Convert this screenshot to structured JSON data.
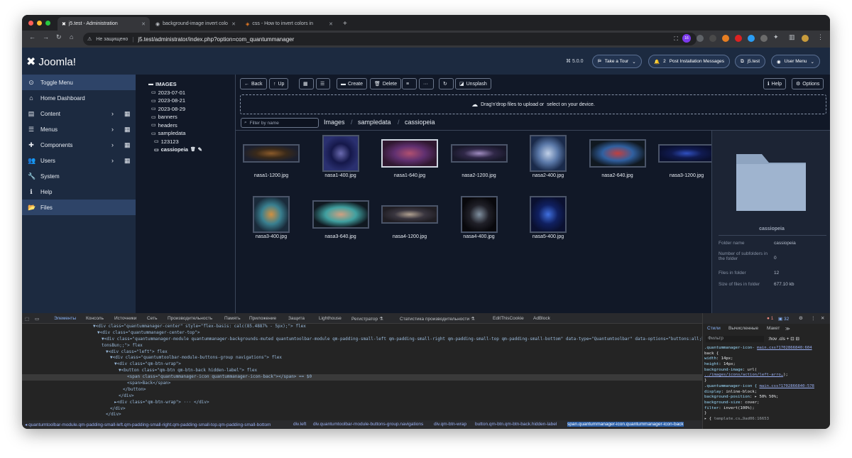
{
  "browser": {
    "tabs": [
      {
        "title": "j5.test - Administration"
      },
      {
        "title": "background-image invert colo"
      },
      {
        "title": "css - How to invert colors in"
      }
    ],
    "new_tab": "+",
    "security": "Не защищено",
    "url": "j5.test/administrator/index.php?option=com_quantummanager",
    "ext_badge": "16"
  },
  "header": {
    "brand": "Joomla!",
    "version": "⌘ 5.0.0",
    "tour": "Take a Tour",
    "notif_count": "2",
    "post_install": "Post Installation Messages",
    "site": "j5.test",
    "user_menu": "User Menu"
  },
  "sidebar": {
    "items": [
      {
        "label": "Toggle Menu",
        "icon": "⊙"
      },
      {
        "label": "Home Dashboard",
        "icon": "⌂"
      },
      {
        "label": "Content",
        "icon": "▤",
        "chev": "›",
        "grid": "▦"
      },
      {
        "label": "Menus",
        "icon": "☰",
        "chev": "›",
        "grid": "▦"
      },
      {
        "label": "Components",
        "icon": "✚",
        "chev": "›",
        "grid": "▦"
      },
      {
        "label": "Users",
        "icon": "👥",
        "chev": "›",
        "grid": "▦"
      },
      {
        "label": "System",
        "icon": "🔧"
      },
      {
        "label": "Help",
        "icon": "ℹ"
      },
      {
        "label": "Files",
        "icon": "📂"
      }
    ]
  },
  "tree": {
    "items": [
      {
        "label": "IMAGES",
        "level": 0,
        "bold": true
      },
      {
        "label": "2023-07-01",
        "level": 1
      },
      {
        "label": "2023-08-21",
        "level": 1
      },
      {
        "label": "2023-08-29",
        "level": 1
      },
      {
        "label": "banners",
        "level": 1
      },
      {
        "label": "headers",
        "level": 1
      },
      {
        "label": "sampledata",
        "level": 1
      },
      {
        "label": "123123",
        "level": 2
      },
      {
        "label": "cassiopeia",
        "level": 2,
        "bold": true
      }
    ]
  },
  "toolbar": {
    "back": "Back",
    "up": "Up",
    "create": "Create",
    "delete": "Delete",
    "more": "···",
    "unsplash": "Unsplash",
    "help": "Help",
    "options": "Options"
  },
  "dropzone": {
    "text1": "Drag'n'drop files to upload or",
    "text2": "select on your device."
  },
  "filter_placeholder": "Filter by name",
  "breadcrumbs": [
    "Images",
    "sampledata",
    "cassiopeia"
  ],
  "files": [
    {
      "name": "nasa1-1200.jpg",
      "colors": [
        "#1b1f2e",
        "#8a5a2a",
        "#3a2a1a"
      ]
    },
    {
      "name": "nasa1-400.jpg",
      "colors": [
        "#2a3070",
        "#6a6ab0",
        "#15184a"
      ]
    },
    {
      "name": "nasa1-640.jpg",
      "colors": [
        "#301830",
        "#b05070",
        "#603070"
      ]
    },
    {
      "name": "nasa2-1200.jpg",
      "colors": [
        "#18182a",
        "#a08cc0",
        "#302848"
      ]
    },
    {
      "name": "nasa2-400.jpg",
      "colors": [
        "#1a2a4a",
        "#c0d0e8",
        "#5a78a8"
      ]
    },
    {
      "name": "nasa2-640.jpg",
      "colors": [
        "#101820",
        "#c04040",
        "#3060a0"
      ]
    },
    {
      "name": "nasa3-1200.jpg",
      "colors": [
        "#0a1030",
        "#3050c0",
        "#101a50"
      ]
    },
    {
      "name": "nasa3-400.jpg",
      "colors": [
        "#1a2a3a",
        "#d09040",
        "#3a8090"
      ]
    },
    {
      "name": "nasa3-640.jpg",
      "colors": [
        "#101820",
        "#d0a080",
        "#40a0a0"
      ]
    },
    {
      "name": "nasa4-1200.jpg",
      "colors": [
        "#201e24",
        "#b0a090",
        "#3a3640"
      ]
    },
    {
      "name": "nasa4-400.jpg",
      "colors": [
        "#08080c",
        "#8090a0",
        "#202028"
      ]
    },
    {
      "name": "nasa5-400.jpg",
      "colors": [
        "#0a1030",
        "#4070e0",
        "#102060"
      ]
    }
  ],
  "selected_file": "nasa1-640.jpg",
  "info": {
    "name": "cassiopeia",
    "rows": [
      {
        "label": "Folder name",
        "value": "cassiopeia"
      },
      {
        "label": "Number of subfolders in the folder",
        "value": "0"
      },
      {
        "label": "Files in folder",
        "value": "12"
      },
      {
        "label": "Size of files in folder",
        "value": "677.10 kb"
      }
    ]
  },
  "devtools": {
    "tabs": [
      "Элементы",
      "Консоль",
      "Источники",
      "Сеть",
      "Производительность",
      "Память",
      "Приложение",
      "Защита",
      "Lighthouse",
      "Регистратор ⚗",
      "Статистика производительности ⚗",
      "EditThisCookie",
      "AdBlock"
    ],
    "errors": "1",
    "warnings": "32",
    "code": [
      "▼<div class=\"quantummanager-center\" style=\"flex-basis: calc(85.4887% - 5px);\"> flex",
      "▼<div class=\"quantummanager-center-top\">",
      "▼<div class=\"quantummanager-module quantummanager-backgrounds-muted quantumtoolbar-module qm-padding-small-left qm-padding-small-right qm-padding-small-top qm-padding-small-bottom\" data-type=\"Quantumtoolbar\" data-options=\"buttons:all;but",
      "tonsBun;;\"> flex",
      "▼<div class=\"left\"> flex",
      "▼<div class=\"quantumtoolbar-module-buttons-group navigations\"> flex",
      "▼<div class=\"qm-btn-wrap\">",
      "▼<button class=\"qm-btn qm-btn-back hidden-label\"> flex",
      "<span class=\"quantummanager-icon quantummanager-icon-back\"></span> == $0",
      "<span>Back</span>",
      "</button>",
      "</div>",
      "►<div class=\"qm-btn-wrap\"> ··· </div>",
      "</div>",
      "</div>"
    ],
    "crumbs": [
      "◂ quantumtoolbar-module.qm-padding-small-left.qm-padding-small-right.qm-padding-small-top.qm-padding-small-bottom",
      "div.left",
      "div.quantumtoolbar-module-buttons-group.navigations",
      "div.qm-btn-wrap",
      "button.qm-btn.qm-btn-back.hidden-label",
      "span.quantummanager-icon.quantummanager-icon-back"
    ],
    "styles_tabs": [
      "Стили",
      "Вычисленные",
      "Макет",
      "≫"
    ],
    "filter": "Фильтр",
    "filter_tools": ":hov .cls + ⊡ ⊟",
    "rules": [
      "<span class=\"prop\">.quantummanager-icon-</span>  <span class=\"lnk\">main.css?1702866840:604</span>",
      "back {",
      "  <span class=\"prop\">width</span>: <span class=\"pv\">14px;</span>",
      "  <span class=\"prop\">height</span>: <span class=\"pv\">14px;</span>",
      "  <span class=\"prop\">background-image</span>: <span class=\"pv\">url(</span>",
      "    <span class=\"lnk\">../images/icons/action/left-arro…</span>);",
      "}",
      "<span class=\"prop\">.quantummanager-icon {</span>  <span class=\"lnk\">main.css?1702866840:578</span>",
      "  <span class=\"prop\">display</span>: <span class=\"pv\">inline-block;</span>",
      "  <span class=\"prop\">background-position</span>: <span class=\"pv\">▸ 50% 50%;</span>",
      "  <span class=\"prop\">background-size</span>: <span class=\"pv\">cover;</span>",
      "  <span class=\"prop\">filter</span>: <span class=\"pv\">invert(100%);</span>",
      "}",
      "▸ {  <span class=\"src\">template.cs…9ad06:16653</span>"
    ]
  }
}
